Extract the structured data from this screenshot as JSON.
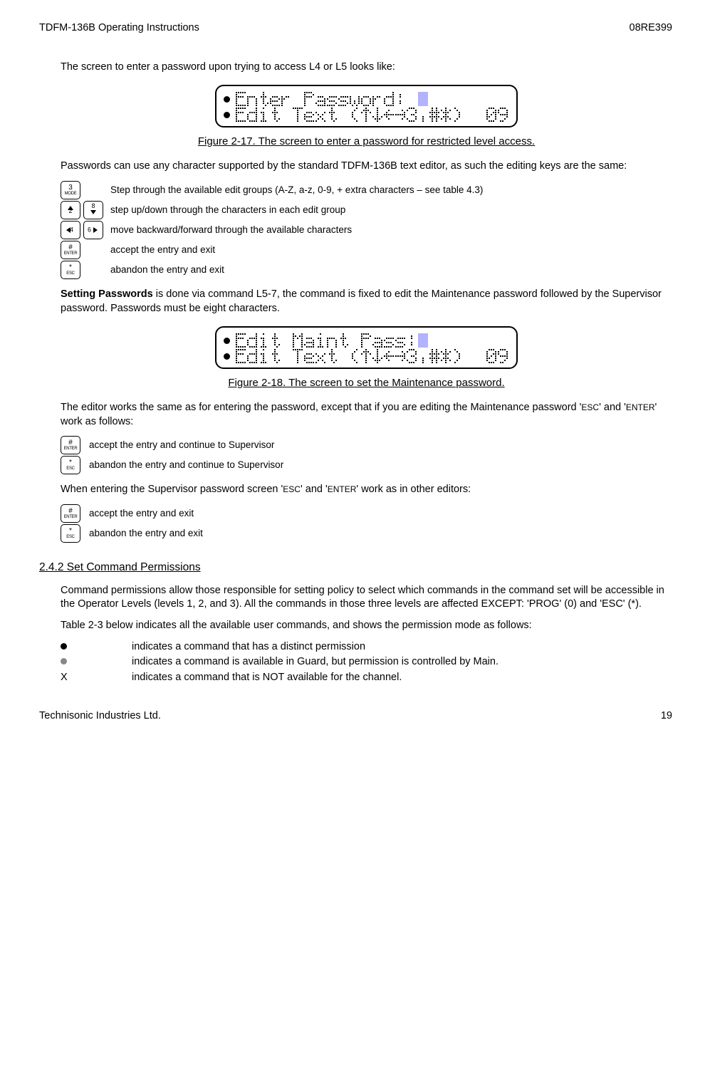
{
  "header": {
    "left": "TDFM-136B Operating Instructions",
    "right": "08RE399"
  },
  "para1": "The screen to enter a password upon trying to access L4 or L5 looks like:",
  "lcd1": {
    "line1": "Enter Password: ",
    "line2": "Edit Text (↑↓←→3,#*)  09",
    "value": "09"
  },
  "caption1": "Figure 2-17. The screen to enter a password for restricted level access.",
  "para2": "Passwords can use any character supported by the standard TDFM-136B text editor, as such the editing keys are the same:",
  "keys1": [
    {
      "btns": [
        {
          "t1": "3",
          "t2": "MODE"
        }
      ],
      "desc": "Step through the available edit groups (A-Z, a-z, 0-9, + extra characters – see table 4.3)"
    },
    {
      "btns": [
        {
          "t1": "2",
          "arrow": "up"
        },
        {
          "t1": "8",
          "arrow": "down"
        }
      ],
      "desc": "step up/down through the characters in each edit group"
    },
    {
      "btns": [
        {
          "t1": "4",
          "arrow": "left"
        },
        {
          "t1": "6",
          "arrow": "right"
        }
      ],
      "desc": "move backward/forward through the available characters"
    },
    {
      "btns": [
        {
          "t1": "#",
          "t2": "ENTER"
        }
      ],
      "desc": "accept the entry and exit"
    },
    {
      "btns": [
        {
          "t1": "*",
          "t2": "ESC"
        }
      ],
      "desc": "abandon the entry and exit"
    }
  ],
  "para3a": "Setting Passwords",
  "para3b": " is done via command L5-7, the command is fixed to edit the Maintenance password followed by the Supervisor password. Passwords must be eight characters.",
  "lcd2": {
    "line1": "Edit Maint Pass:",
    "line2": "Edit Text (↑↓←→3,#*)  09",
    "value": "09"
  },
  "caption2": "Figure 2-18. The screen to set the Maintenance password.",
  "para4a": "The editor works the same as for entering the password, except that if you are editing the Maintenance password '",
  "para4b": "ESC",
  "para4c": "' and '",
  "para4d": "ENTER",
  "para4e": "' work as follows:",
  "keys2": [
    {
      "btns": [
        {
          "t1": "#",
          "t2": "ENTER"
        }
      ],
      "desc": "accept the entry and continue to Supervisor"
    },
    {
      "btns": [
        {
          "t1": "*",
          "t2": "ESC"
        }
      ],
      "desc": "abandon the entry and continue to  Supervisor"
    }
  ],
  "para5a": "When entering the Supervisor password screen  '",
  "para5b": "ESC",
  "para5c": "' and '",
  "para5d": "ENTER",
  "para5e": "' work as in other editors:",
  "keys3": [
    {
      "btns": [
        {
          "t1": "#",
          "t2": "ENTER"
        }
      ],
      "desc": "accept the entry and exit"
    },
    {
      "btns": [
        {
          "t1": "*",
          "t2": "ESC"
        }
      ],
      "desc": "abandon the entry and exit"
    }
  ],
  "section": "2.4.2   Set Command Permissions",
  "para6": "Command permissions allow those responsible for setting policy to select which commands in the command set will be accessible in the Operator Levels (levels 1, 2, and 3). All the commands in those three levels are affected EXCEPT: 'PROG' (0) and 'ESC' (*).",
  "para7": "Table 2-3 below indicates all the available user commands, and shows the permission mode as follows:",
  "bullets": [
    {
      "sym": "solid",
      "text": "indicates a command that has a distinct permission"
    },
    {
      "sym": "gray",
      "text": "indicates a command is available in Guard, but permission is controlled by Main."
    },
    {
      "sym": "X",
      "text": "indicates a command that is NOT available for the channel."
    }
  ],
  "footer": {
    "left": "Technisonic Industries Ltd.",
    "right": "19"
  }
}
